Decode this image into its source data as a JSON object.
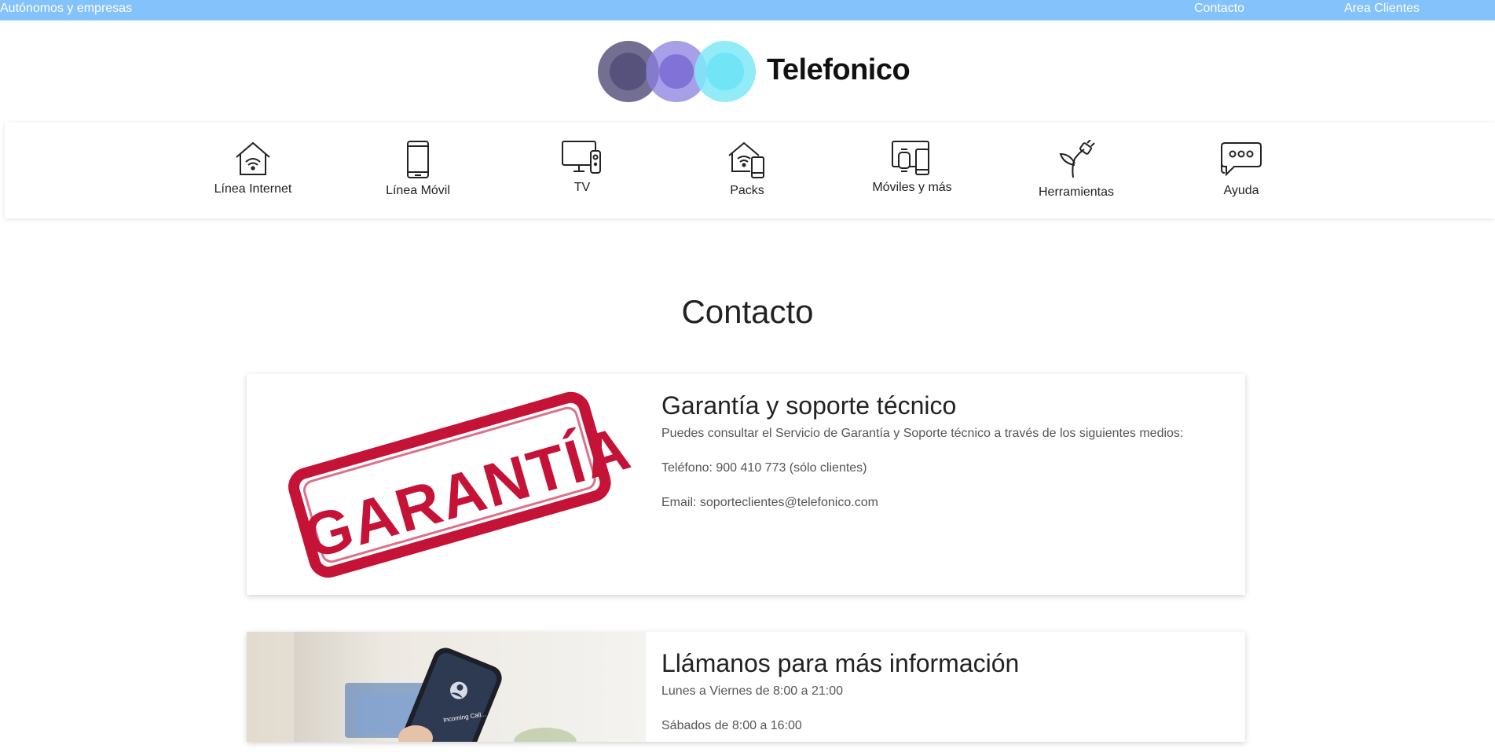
{
  "topbar": {
    "left_label": "Autónomos y empresas",
    "contact_label": "Contacto",
    "clients_label": "Area Clientes",
    "color": "#84c2fb"
  },
  "brand": {
    "name": "Telefonico"
  },
  "nav": {
    "items": [
      {
        "label": "Línea Internet",
        "icon": "house-wifi-icon"
      },
      {
        "label": "Línea Móvil",
        "icon": "smartphone-icon"
      },
      {
        "label": "TV",
        "icon": "tv-icon"
      },
      {
        "label": "Packs",
        "icon": "house-phone-icon"
      },
      {
        "label": "Móviles y más",
        "icon": "devices-icon"
      },
      {
        "label": "Herramientas",
        "icon": "plant-plug-icon"
      },
      {
        "label": "Ayuda",
        "icon": "chat-bubble-icon"
      }
    ]
  },
  "page": {
    "title": "Contacto"
  },
  "cards": [
    {
      "title": "Garantía y soporte técnico",
      "image_text": "GARANTÍA",
      "lines": [
        "Puedes consultar el Servicio de Garantía y Soporte técnico a través de los siguientes medios:",
        "Teléfono: 900 410 773 (sólo clientes)",
        "Email: soporteclientes@telefonico.com"
      ]
    },
    {
      "title": "Llámanos para más información",
      "image_text": "Incoming Call...",
      "lines": [
        "Lunes a Viernes de 8:00 a 21:00",
        "Sábados de 8:00 a 16:00"
      ]
    }
  ],
  "colors": {
    "accent": "#84c2fb",
    "stamp": "#c51338"
  }
}
